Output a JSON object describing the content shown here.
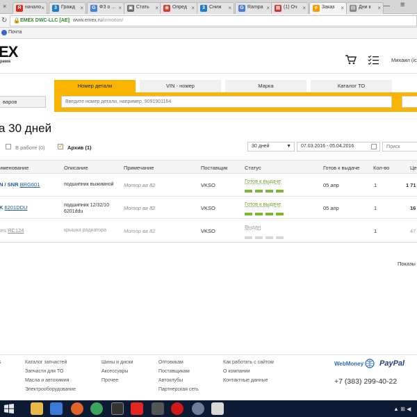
{
  "browser": {
    "tabs": [
      {
        "label": "начало",
        "fav": "Я",
        "color": "#e52620"
      },
      {
        "label": "Гражд",
        "fav": "3",
        "color": "#1e7cc8"
      },
      {
        "label": "ФЗ о ...",
        "fav": "G",
        "color": "#4a7fd6"
      },
      {
        "label": "Стать",
        "fav": "▣",
        "color": "#6a6a6a"
      },
      {
        "label": "Опред",
        "fav": "◉",
        "color": "#d43b2a"
      },
      {
        "label": "Сниж",
        "fav": "3",
        "color": "#1e7cc8"
      },
      {
        "label": "Rampa",
        "fav": "G",
        "color": "#4a7fd6"
      },
      {
        "label": "(1) Оч",
        "fav": "▦",
        "color": "#c0392b"
      },
      {
        "label": "Заказ",
        "fav": "e",
        "color": "#f5a000"
      },
      {
        "label": "Дни к",
        "fav": "▤",
        "color": "#888888"
      }
    ],
    "site_badge": "EMEX DWC-LLC [AE]",
    "url_host": "www.emex.ru",
    "url_path": "/inmotion/",
    "bookmark": "Почта"
  },
  "header": {
    "logo_text": "EX",
    "logo_sub": "ремя",
    "user": "Михаил (ic"
  },
  "search": {
    "left_button": "варов",
    "tabs": [
      "Номер детали",
      "VIN - номер",
      "Марка",
      "Каталог ТО"
    ],
    "placeholder": "Введите номер детали, например, 9091901164"
  },
  "page": {
    "title": "а 30 дней",
    "filters": {
      "in_work": "В работе (0)",
      "archive": "Архив (1)"
    },
    "period_select": "30 дней",
    "date_range": "07.03.2016 - 05.04.2016",
    "search_placeholder": "Поиск"
  },
  "table": {
    "headers": [
      "именование",
      "Описание",
      "Примечание",
      "Поставщик",
      "Статус",
      "Готов к выдаче",
      "Кол-во",
      "Це"
    ],
    "rows": [
      {
        "brand": "N / SNR",
        "code": "BRG601",
        "desc": "подшипник выжимной",
        "note": "Мотор ва 82",
        "supplier": "VKSO",
        "status": "Готов к выдаче",
        "ready": "05 апр",
        "qty": "1",
        "price": "1 71"
      },
      {
        "brand": "K",
        "code": "6201DDU",
        "desc": "подшипник 12/32/10 6201ddu",
        "note": "Мотор ва 82",
        "supplier": "VKSO",
        "status": "Готов к выдаче",
        "ready": "05 апр",
        "qty": "1",
        "price": "16"
      },
      {
        "brand": "tes",
        "code": "RC124",
        "desc": "крышка радиатора",
        "note": "Мотор ва 82",
        "supplier": "VKSO",
        "status": "Выдан",
        "ready": "",
        "qty": "1",
        "price": "47"
      }
    ],
    "show_label": "Показы"
  },
  "footer": {
    "col1": [
      "Каталог запчастей",
      "Запчасти для ТО",
      "Масла и автохимия",
      "Электрооборудование"
    ],
    "col2": [
      "Шины и диски",
      "Аксессуары",
      "Прочее"
    ],
    "col3": [
      "Оптовикам",
      "Поставщикам",
      "Автоклубы",
      "Партнерская сеть"
    ],
    "col4": [
      "Как работать с сайтом",
      "О компании",
      "Контактные данные"
    ],
    "webmoney": "WebMoney",
    "paypal": "PayPal",
    "phone": "+7 (383) 299-40-22"
  },
  "colors": {
    "accent": "#f8b400",
    "ready": "#7cb82f",
    "link": "#1e5b9f"
  }
}
